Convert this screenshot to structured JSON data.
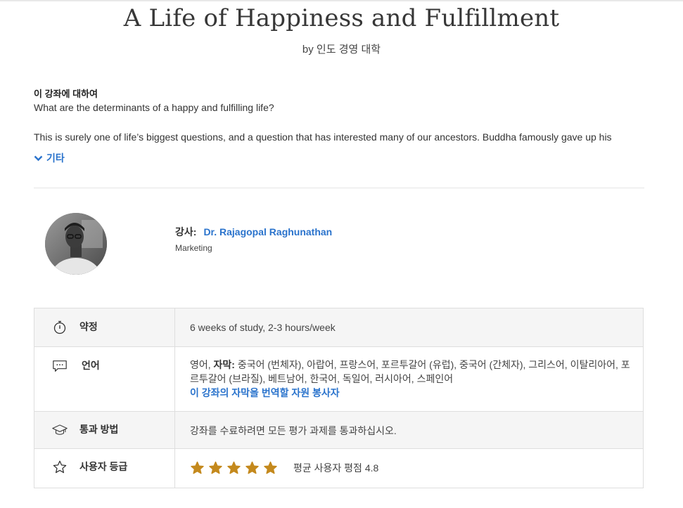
{
  "course": {
    "title": "A Life of Happiness and Fulfillment",
    "byline": "by 인도 경영 대학"
  },
  "about": {
    "heading": "이 강좌에 대하여",
    "subtitle": "What are the determinants of a happy and fulfilling life?",
    "body": "This is surely one of life’s biggest questions, and a question that has interested many of our ancestors. Buddha famously gave up his",
    "more_label": "기타"
  },
  "instructor": {
    "label": "강사:",
    "name": "Dr. Rajagopal Raghunathan",
    "department": "Marketing"
  },
  "info": {
    "commitment": {
      "label": "약정",
      "value": "6 weeks of study, 2-3 hours/week"
    },
    "language": {
      "label": "언어",
      "primary": "영어,",
      "subtitles_label": "자막:",
      "subtitles": "중국어 (번체자), 아랍어, 프랑스어, 포르투갈어 (유럽), 중국어 (간체자), 그리스어, 이탈리아어, 포르투갈어 (브라질), 베트남어, 한국어, 독일어, 러시아어, 스페인어",
      "volunteer_link": "이 강좌의 자막을 번역할 자원 봉사자"
    },
    "passing": {
      "label": "통과 방법",
      "value": "강좌를 수료하려면 모든 평가 과제를 통과하십시오."
    },
    "rating": {
      "label": "사용자 등급",
      "value": 4.8,
      "text": "평균 사용자 평점 4.8",
      "max": 5
    }
  },
  "colors": {
    "link": "#2a73cc",
    "star": "#c4891d",
    "row_shade": "#f5f5f5",
    "border": "#dedede"
  },
  "icons": {
    "more": "chevron-down-icon",
    "commitment": "stopwatch-icon",
    "language": "chat-bubble-icon",
    "passing": "graduation-cap-icon",
    "rating": "star-outline-icon"
  }
}
